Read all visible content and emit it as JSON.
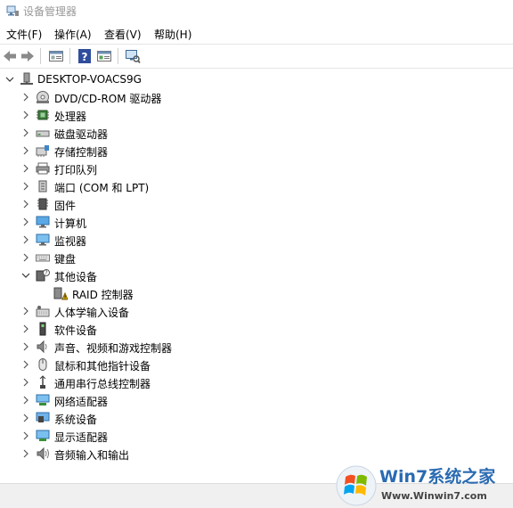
{
  "window": {
    "title": "设备管理器"
  },
  "menu": [
    "文件(F)",
    "操作(A)",
    "查看(V)",
    "帮助(H)"
  ],
  "toolbar": {
    "buttons": [
      "back-icon",
      "forward-icon",
      "properties-icon",
      "help-icon",
      "update-driver-icon",
      "scan-hardware-icon"
    ]
  },
  "tree": {
    "root": "DESKTOP-VOACS9G",
    "categories": [
      {
        "label": "DVD/CD-ROM 驱动器",
        "icon": "dvd-drive-icon",
        "expanded": false
      },
      {
        "label": "处理器",
        "icon": "processor-icon",
        "expanded": false
      },
      {
        "label": "磁盘驱动器",
        "icon": "disk-drive-icon",
        "expanded": false
      },
      {
        "label": "存储控制器",
        "icon": "storage-controller-icon",
        "expanded": false
      },
      {
        "label": "打印队列",
        "icon": "printer-icon",
        "expanded": false
      },
      {
        "label": "端口 (COM 和 LPT)",
        "icon": "port-icon",
        "expanded": false
      },
      {
        "label": "固件",
        "icon": "firmware-icon",
        "expanded": false
      },
      {
        "label": "计算机",
        "icon": "computer-icon",
        "expanded": false
      },
      {
        "label": "监视器",
        "icon": "monitor-icon",
        "expanded": false
      },
      {
        "label": "键盘",
        "icon": "keyboard-icon",
        "expanded": false
      },
      {
        "label": "其他设备",
        "icon": "other-devices-icon",
        "expanded": true,
        "children": [
          {
            "label": "RAID 控制器",
            "icon": "warning-device-icon"
          }
        ]
      },
      {
        "label": "人体学输入设备",
        "icon": "hid-icon",
        "expanded": false
      },
      {
        "label": "软件设备",
        "icon": "software-device-icon",
        "expanded": false
      },
      {
        "label": "声音、视频和游戏控制器",
        "icon": "sound-icon",
        "expanded": false
      },
      {
        "label": "鼠标和其他指针设备",
        "icon": "mouse-icon",
        "expanded": false
      },
      {
        "label": "通用串行总线控制器",
        "icon": "usb-icon",
        "expanded": false
      },
      {
        "label": "网络适配器",
        "icon": "network-adapter-icon",
        "expanded": false
      },
      {
        "label": "系统设备",
        "icon": "system-device-icon",
        "expanded": false
      },
      {
        "label": "显示适配器",
        "icon": "display-adapter-icon",
        "expanded": false
      },
      {
        "label": "音频输入和输出",
        "icon": "audio-io-icon",
        "expanded": false
      }
    ]
  },
  "watermark": {
    "brand": "Win7系统之家",
    "url": "Www.Winwin7.com"
  }
}
